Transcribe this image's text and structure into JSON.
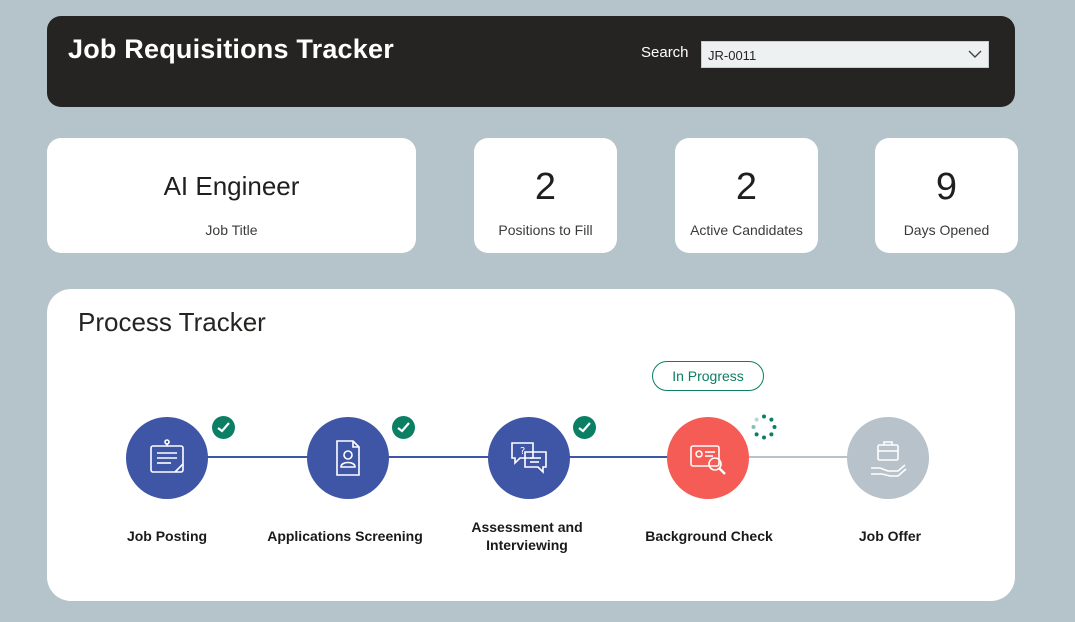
{
  "header": {
    "title": "Job Requisitions Tracker",
    "search_label": "Search",
    "search_value": "JR-0011"
  },
  "kpis": {
    "job_title": {
      "value": "AI Engineer",
      "label": "Job Title"
    },
    "positions": {
      "value": "2",
      "label": "Positions to Fill"
    },
    "candidates": {
      "value": "2",
      "label": "Active Candidates"
    },
    "days": {
      "value": "9",
      "label": "Days Opened"
    }
  },
  "tracker": {
    "title": "Process Tracker",
    "status_badge": "In Progress",
    "steps": [
      {
        "label": "Job Posting",
        "status": "completed",
        "icon": "note-board-icon"
      },
      {
        "label": "Applications Screening",
        "status": "completed",
        "icon": "resume-document-icon"
      },
      {
        "label": "Assessment and Interviewing",
        "status": "completed",
        "icon": "chat-bubbles-icon"
      },
      {
        "label": "Background Check",
        "status": "in-progress",
        "icon": "id-card-search-icon"
      },
      {
        "label": "Job Offer",
        "status": "pending",
        "icon": "briefcase-hand-icon"
      }
    ]
  },
  "colors": {
    "page_bg": "#b5c3cb",
    "header_bg": "#252423",
    "completed": "#3f55a6",
    "in_progress": "#f45c55",
    "pending": "#b8c2ca",
    "check": "#0a7f63"
  }
}
